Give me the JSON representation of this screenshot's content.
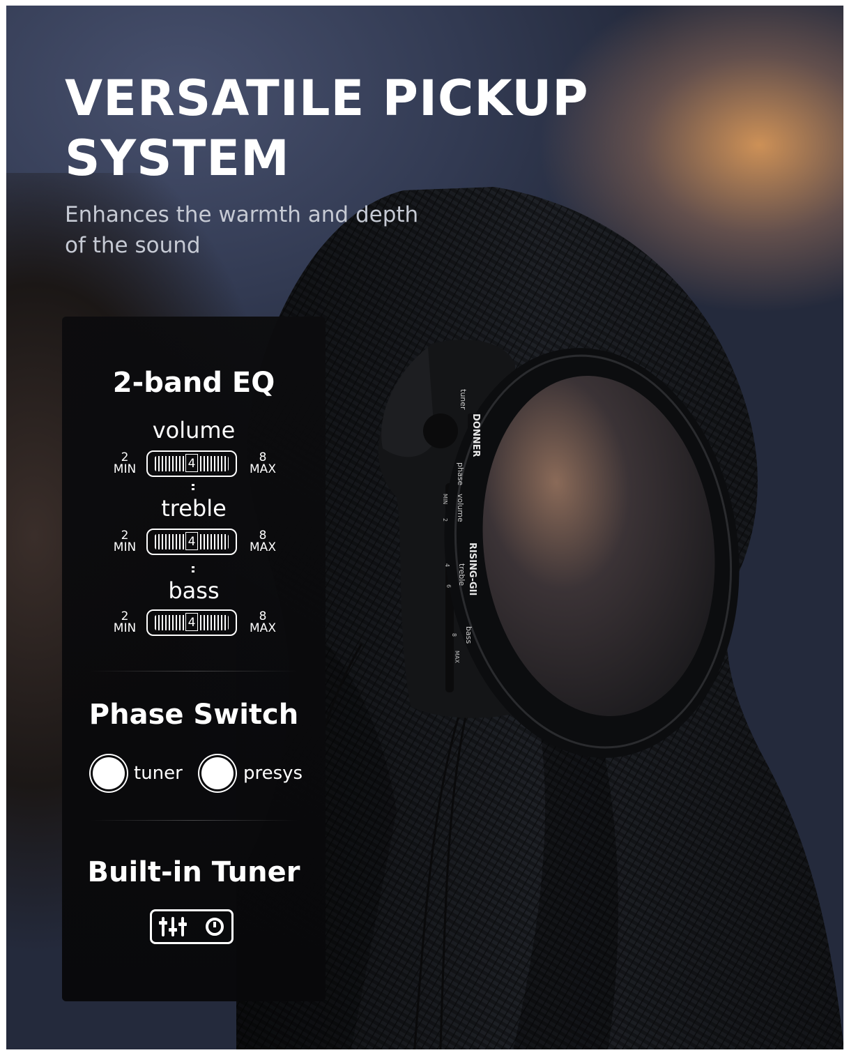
{
  "header": {
    "title_line1": "VERSATILE PICKUP",
    "title_line2": "SYSTEM",
    "subtitle_line1": "Enhances the warmth and depth",
    "subtitle_line2": "of the sound"
  },
  "panel": {
    "eq": {
      "title": "2-band EQ",
      "bands": [
        {
          "label": "volume",
          "min_num": "2",
          "min_text": "MIN",
          "max_num": "8",
          "max_text": "MAX",
          "value": "4"
        },
        {
          "label": "treble",
          "min_num": "2",
          "min_text": "MIN",
          "max_num": "8",
          "max_text": "MAX",
          "value": "4"
        },
        {
          "label": "bass",
          "min_num": "2",
          "min_text": "MIN",
          "max_num": "8",
          "max_text": "MAX",
          "value": "4"
        }
      ]
    },
    "phase": {
      "title": "Phase Switch",
      "options": [
        "tuner",
        "presys"
      ]
    },
    "tuner": {
      "title": "Built-in Tuner",
      "icon": "tuner-sliders-icon"
    }
  },
  "device_labels": {
    "brand": "DONNER",
    "model": "RISING-GII",
    "tuner": "tuner",
    "phase": "phase",
    "volume": "volume",
    "treble": "treble",
    "bass": "bass",
    "min": "MIN",
    "max": "MAX",
    "n2": "2",
    "n4": "4",
    "n6": "6",
    "n8": "8"
  },
  "colors": {
    "panel_bg": "#0b0b0d",
    "text": "#ffffff",
    "subtitle": "#c6cad4",
    "warm_glow": "#d6965a"
  }
}
